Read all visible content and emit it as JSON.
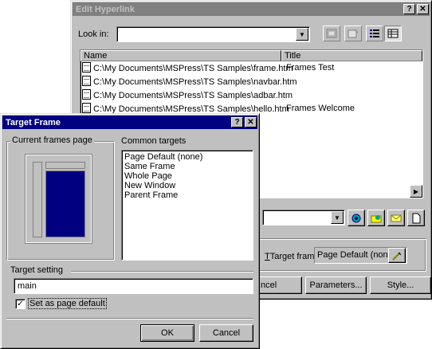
{
  "edit_hyperlink": {
    "title": "Edit Hyperlink",
    "help_btn": "?",
    "close_btn": "✕",
    "look_in_label": "Look in:",
    "look_in_value": "",
    "columns": [
      "Name",
      "Title"
    ],
    "files": [
      {
        "name": "C:\\My Documents\\MSPress\\TS Samples\\frame.htm",
        "title": "Frames Test"
      },
      {
        "name": "C:\\My Documents\\MSPress\\TS Samples\\navbar.htm",
        "title": ""
      },
      {
        "name": "C:\\My Documents\\MSPress\\TS Samples\\adbar.htm",
        "title": ""
      },
      {
        "name": "C:\\My Documents\\MSPress\\TS Samples\\hello.htm",
        "title": "Frames Welcome"
      }
    ],
    "target_frame_label": "Target frame",
    "target_frame_value": "Page Default (none)",
    "cancel_label": "ncel",
    "parameters_label": "Parameters...",
    "style_label": "Style..."
  },
  "target_frame": {
    "title": "Target Frame",
    "help_btn": "?",
    "close_btn": "✕",
    "current_frames_label": "Current frames page",
    "common_targets_label": "Common targets",
    "common_targets": [
      "Page Default (none)",
      "Same Frame",
      "Whole Page",
      "New Window",
      "Parent Frame"
    ],
    "target_setting_label": "Target setting",
    "target_setting_value": "main",
    "set_default_label": "Set as page default",
    "set_default_checked": "✓",
    "ok_label": "OK",
    "cancel_label": "Cancel"
  }
}
